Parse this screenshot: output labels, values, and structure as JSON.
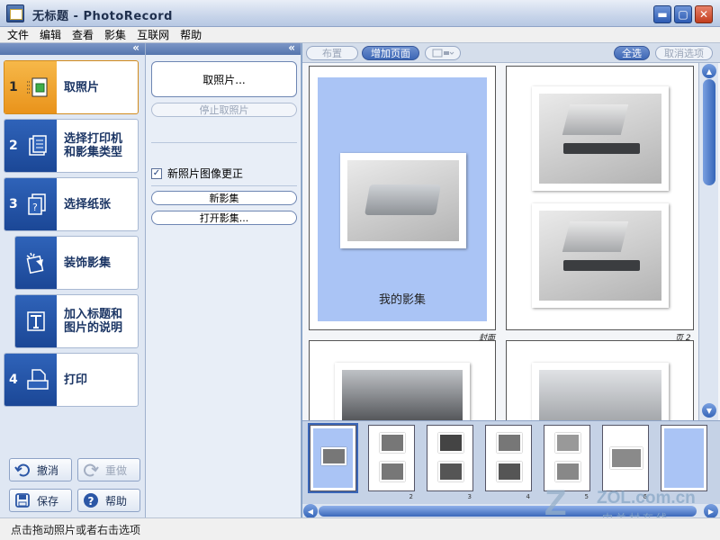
{
  "window": {
    "title": "无标题 - PhotoRecord",
    "controls": {
      "minimize": "▬",
      "maximize": "▢",
      "close": "✕"
    }
  },
  "menu": [
    "文件",
    "编辑",
    "查看",
    "影集",
    "互联网",
    "帮助"
  ],
  "collapse_glyph": "«",
  "steps": [
    {
      "num": "1",
      "label": "取照片",
      "icon": "get-photo-icon",
      "active": true
    },
    {
      "num": "2",
      "label": "选择打印机\n和影集类型",
      "label_lines": [
        "选择打印机",
        "和影集类型"
      ],
      "icon": "printer-album-icon"
    },
    {
      "num": "3",
      "label": "选择纸张",
      "icon": "paper-icon"
    },
    {
      "num": "",
      "label": "装饰影集",
      "icon": "decorate-icon"
    },
    {
      "num": "",
      "label_lines": [
        "加入标题和",
        "图片的说明"
      ],
      "icon": "title-caption-icon"
    },
    {
      "num": "4",
      "label": "打印",
      "icon": "print-icon"
    }
  ],
  "bottom_buttons": {
    "undo": "撤消",
    "redo": "重做",
    "save": "保存",
    "help": "帮助"
  },
  "middle": {
    "get_photo": "取照片...",
    "stop_get_photo": "停止取照片",
    "refresh_checkbox": "新照片图像更正",
    "refresh_checked": true,
    "new_album": "新影集",
    "open_album": "打开影集..."
  },
  "toolbar": {
    "layout": "布置",
    "add_page": "增加页面",
    "select_all": "全选",
    "deselect": "取消选项"
  },
  "pages": {
    "cover_title": "我的影集",
    "cover_label": "封面",
    "page2_label": "页 2"
  },
  "thumbnails": [
    "",
    "2",
    "3",
    "4",
    "5",
    "6",
    ""
  ],
  "watermark": {
    "z": "Z",
    "domain": "ZOL.com.cn",
    "cn": "中关村在线"
  },
  "status": "点击拖动照片或者右击选项",
  "colors": {
    "accent": "#2f63b9",
    "active_step": "#f6b849",
    "cover_bg": "#aac4f5"
  }
}
